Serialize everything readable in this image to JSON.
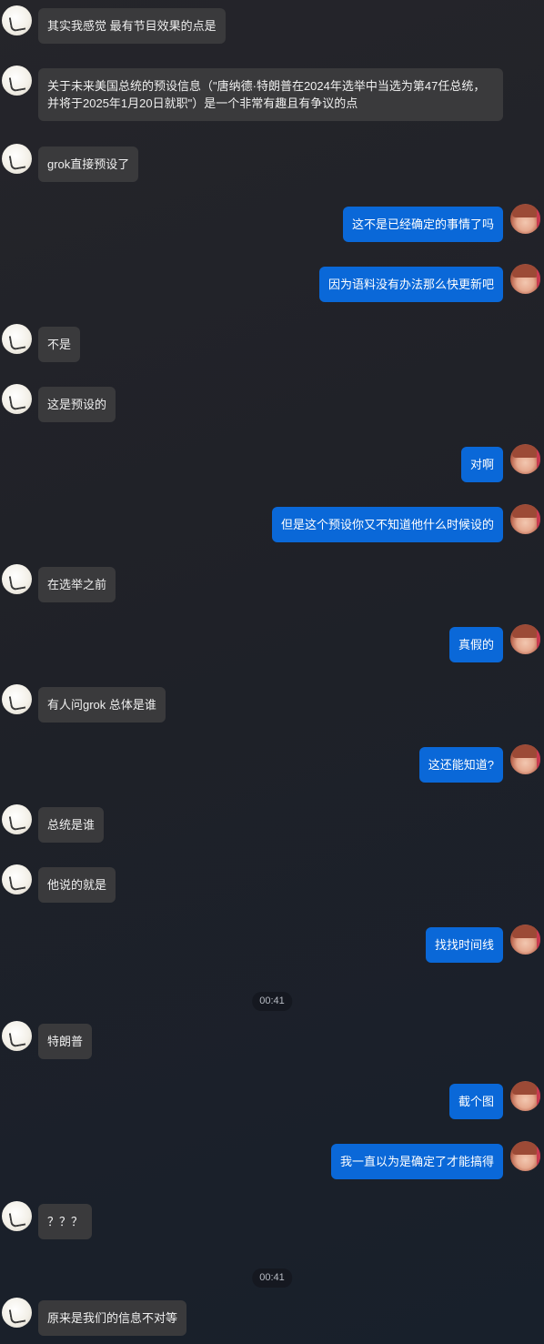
{
  "messages": [
    {
      "side": "left",
      "text": "其实我感觉 最有节目效果的点是"
    },
    {
      "side": "left",
      "text": "关于未来美国总统的预设信息（\"唐纳德·特朗普在2024年选举中当选为第47任总统，并将于2025年1月20日就职\"）是一个非常有趣且有争议的点"
    },
    {
      "side": "left",
      "text": "grok直接预设了"
    },
    {
      "side": "right",
      "text": "这不是已经确定的事情了吗"
    },
    {
      "side": "right",
      "text": "因为语料没有办法那么快更新吧"
    },
    {
      "side": "left",
      "text": "不是"
    },
    {
      "side": "left",
      "text": "这是预设的"
    },
    {
      "side": "right",
      "text": "对啊"
    },
    {
      "side": "right",
      "text": "但是这个预设你又不知道他什么时候设的"
    },
    {
      "side": "left",
      "text": "在选举之前"
    },
    {
      "side": "right",
      "text": "真假的"
    },
    {
      "side": "left",
      "text": "有人问grok 总体是谁"
    },
    {
      "side": "right",
      "text": "这还能知道?"
    },
    {
      "side": "left",
      "text": "总统是谁"
    },
    {
      "side": "left",
      "text": "他说的就是"
    },
    {
      "side": "right",
      "text": "找找时间线"
    },
    {
      "side": "time",
      "text": "00:41"
    },
    {
      "side": "left",
      "text": "特朗普"
    },
    {
      "side": "right",
      "text": "截个图"
    },
    {
      "side": "right",
      "text": "我一直以为是确定了才能搞得"
    },
    {
      "side": "left",
      "text": "？？？"
    },
    {
      "side": "time",
      "text": "00:41"
    },
    {
      "side": "left",
      "text": "原来是我们的信息不对等"
    }
  ]
}
